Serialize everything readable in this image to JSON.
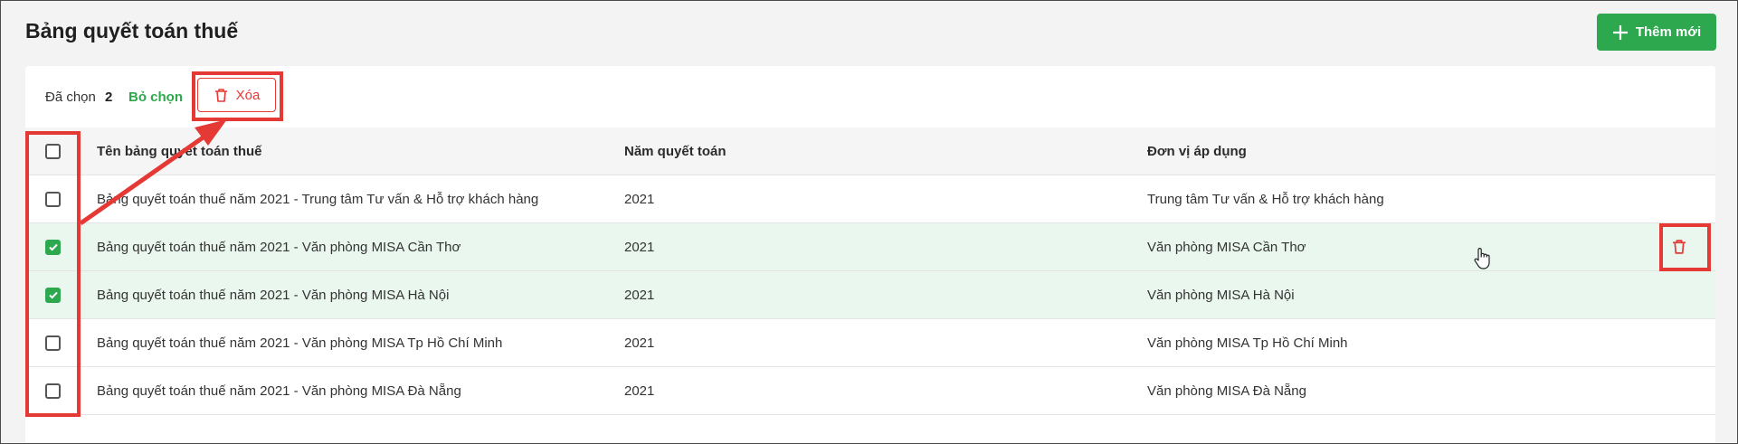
{
  "header": {
    "title": "Bảng quyết toán thuế",
    "add_label": "Thêm mới"
  },
  "toolbar": {
    "selected_label": "Đã chọn",
    "selected_count": "2",
    "unselect_label": "Bỏ chọn",
    "delete_label": "Xóa"
  },
  "table": {
    "columns": [
      "Tên bảng quyết toán thuế",
      "Năm quyết toán",
      "Đơn vị áp dụng"
    ],
    "rows": [
      {
        "name": "Bảng quyết toán thuế năm 2021 - Trung tâm Tư vấn & Hỗ trợ khách hàng",
        "year": "2021",
        "unit": "Trung tâm Tư vấn & Hỗ trợ khách hàng",
        "checked": false
      },
      {
        "name": "Bảng quyết toán thuế năm 2021 - Văn phòng MISA Cần Thơ",
        "year": "2021",
        "unit": "Văn phòng MISA Cần Thơ",
        "checked": true
      },
      {
        "name": "Bảng quyết toán thuế năm 2021 - Văn phòng MISA Hà Nội",
        "year": "2021",
        "unit": "Văn phòng MISA Hà Nội",
        "checked": true
      },
      {
        "name": "Bảng quyết toán thuế năm 2021 - Văn phòng MISA Tp Hồ Chí Minh",
        "year": "2021",
        "unit": "Văn phòng MISA Tp Hồ Chí Minh",
        "checked": false
      },
      {
        "name": "Bảng quyết toán thuế năm 2021 - Văn phòng MISA Đà Nẵng",
        "year": "2021",
        "unit": "Văn phòng MISA Đà Nẵng",
        "checked": false
      }
    ]
  },
  "colors": {
    "accent": "#2da84e",
    "danger": "#e53935",
    "selected_row": "#eaf7ee"
  },
  "icons": [
    "plus-icon",
    "trash-icon",
    "check-icon",
    "hand-cursor-icon"
  ]
}
